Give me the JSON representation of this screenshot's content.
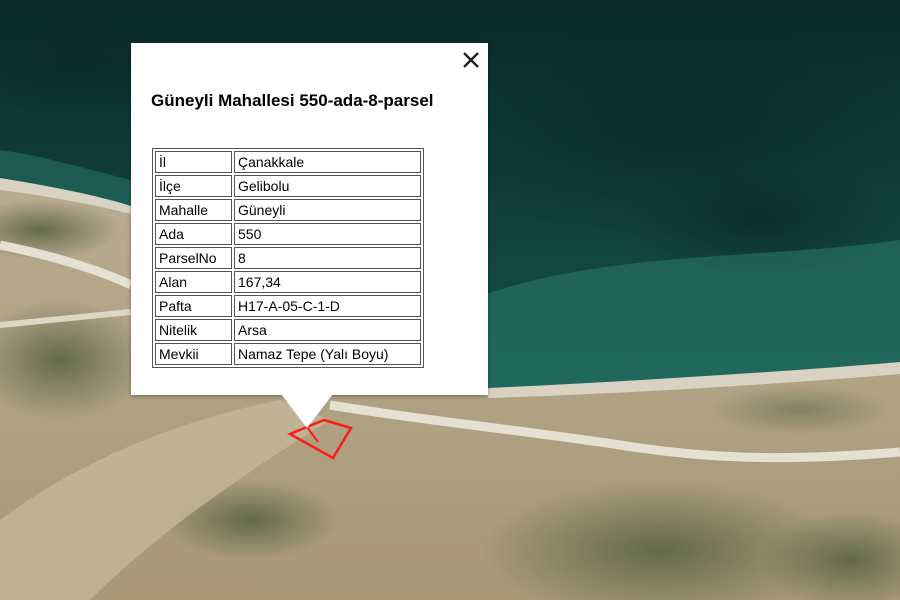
{
  "popup": {
    "title": "Güneyli Mahallesi 550-ada-8-parsel",
    "close_icon": "close-icon",
    "rows": [
      {
        "key": "İl",
        "value": "Çanakkale"
      },
      {
        "key": "İlçe",
        "value": "Gelibolu"
      },
      {
        "key": "Mahalle",
        "value": "Güneyli"
      },
      {
        "key": "Ada",
        "value": "550"
      },
      {
        "key": "ParselNo",
        "value": "8"
      },
      {
        "key": "Alan",
        "value": "167,34"
      },
      {
        "key": "Pafta",
        "value": "H17-A-05-C-1-D"
      },
      {
        "key": "Nitelik",
        "value": "Arsa"
      },
      {
        "key": "Mevkii",
        "value": "Namaz Tepe (Yalı Boyu)"
      }
    ]
  },
  "map": {
    "type": "satellite",
    "parcel_outline_color": "#ff1a1a",
    "sea_color": "#0f3f3c",
    "land_color": "#b5a68a"
  }
}
